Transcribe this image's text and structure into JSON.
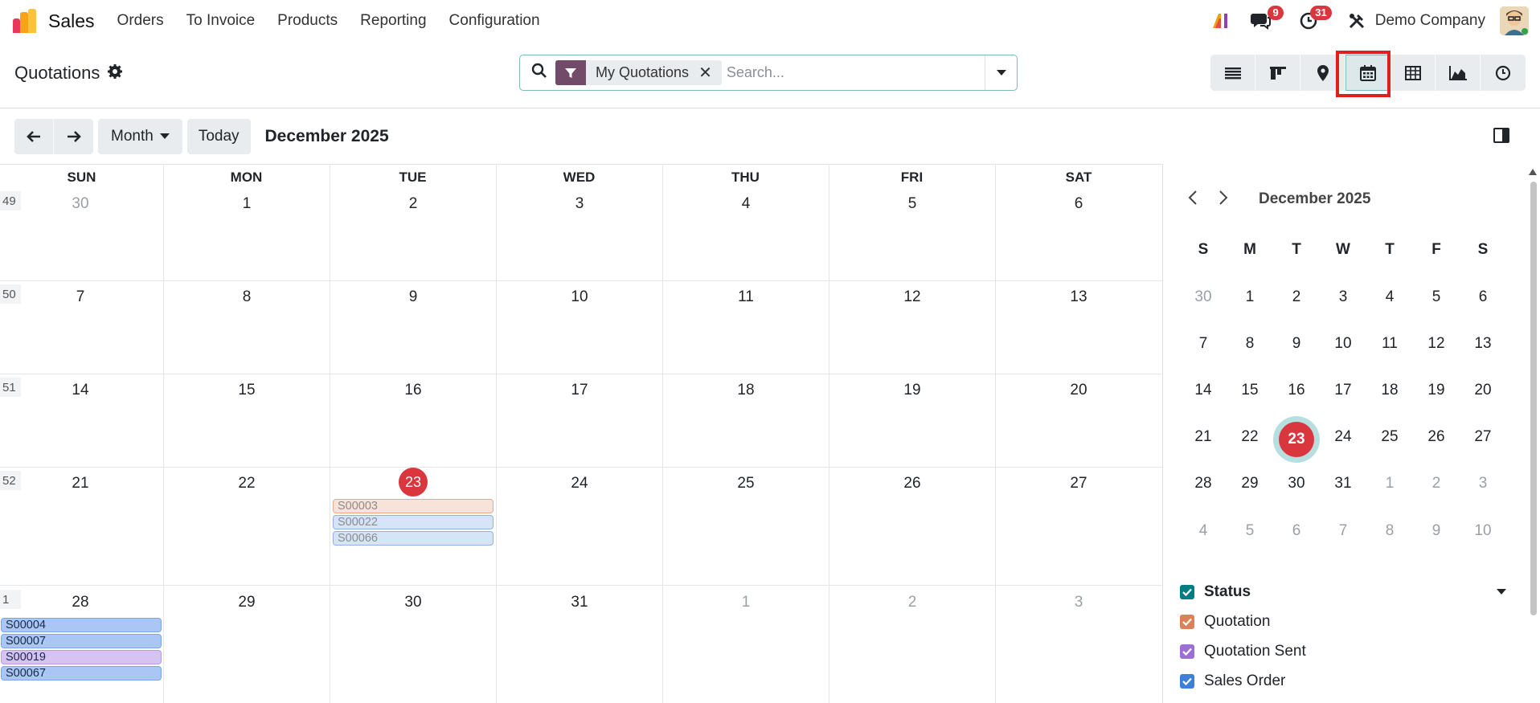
{
  "navbar": {
    "brand": "Sales",
    "menu": [
      "Orders",
      "To Invoice",
      "Products",
      "Reporting",
      "Configuration"
    ],
    "messages_count": "9",
    "activities_count": "31",
    "company": "Demo Company"
  },
  "control_panel": {
    "title": "Quotations",
    "facet_label": "My Quotations",
    "search_placeholder": "Search...",
    "views": [
      "list",
      "kanban",
      "map",
      "calendar",
      "pivot",
      "graph",
      "activity"
    ],
    "active_view": "calendar"
  },
  "calendar": {
    "today_label": "Today",
    "scale_label": "Month",
    "range_label": "December 2025",
    "day_headers": [
      "SUN",
      "MON",
      "TUE",
      "WED",
      "THU",
      "FRI",
      "SAT"
    ],
    "weeks": [
      {
        "week": "49",
        "days": [
          "30",
          "1",
          "2",
          "3",
          "4",
          "5",
          "6"
        ]
      },
      {
        "week": "50",
        "days": [
          "7",
          "8",
          "9",
          "10",
          "11",
          "12",
          "13"
        ]
      },
      {
        "week": "51",
        "days": [
          "14",
          "15",
          "16",
          "17",
          "18",
          "19",
          "20"
        ]
      },
      {
        "week": "52",
        "days": [
          "21",
          "22",
          "23",
          "24",
          "25",
          "26",
          "27"
        ]
      },
      {
        "week": "1",
        "days": [
          "28",
          "29",
          "30",
          "31",
          "1",
          "2",
          "3"
        ]
      }
    ],
    "today": "23",
    "events_tue_23": [
      {
        "ref": "S00003",
        "status": "quotation"
      },
      {
        "ref": "S00022",
        "status": "sale"
      },
      {
        "ref": "S00066",
        "status": "sale"
      }
    ],
    "events_sun_28": [
      {
        "ref": "S00004",
        "status": "sale"
      },
      {
        "ref": "S00007",
        "status": "sale"
      },
      {
        "ref": "S00019",
        "status": "sent"
      },
      {
        "ref": "S00067",
        "status": "sale"
      }
    ]
  },
  "sidebar": {
    "mini_title": "December 2025",
    "dow": [
      "S",
      "M",
      "T",
      "W",
      "T",
      "F",
      "S"
    ],
    "rows": [
      [
        "30",
        "1",
        "2",
        "3",
        "4",
        "5",
        "6"
      ],
      [
        "7",
        "8",
        "9",
        "10",
        "11",
        "12",
        "13"
      ],
      [
        "14",
        "15",
        "16",
        "17",
        "18",
        "19",
        "20"
      ],
      [
        "21",
        "22",
        "23",
        "24",
        "25",
        "26",
        "27"
      ],
      [
        "28",
        "29",
        "30",
        "31",
        "1",
        "2",
        "3"
      ],
      [
        "4",
        "5",
        "6",
        "7",
        "8",
        "9",
        "10"
      ]
    ],
    "filter_title": "Status",
    "filters": [
      "Quotation",
      "Quotation Sent",
      "Sales Order"
    ]
  },
  "colors": {
    "brand": "#714b67",
    "accent": "#017e84",
    "today": "#d9363e",
    "quotation": "#d9825b",
    "sent": "#9b6fd6",
    "sale": "#3f7fd8"
  }
}
